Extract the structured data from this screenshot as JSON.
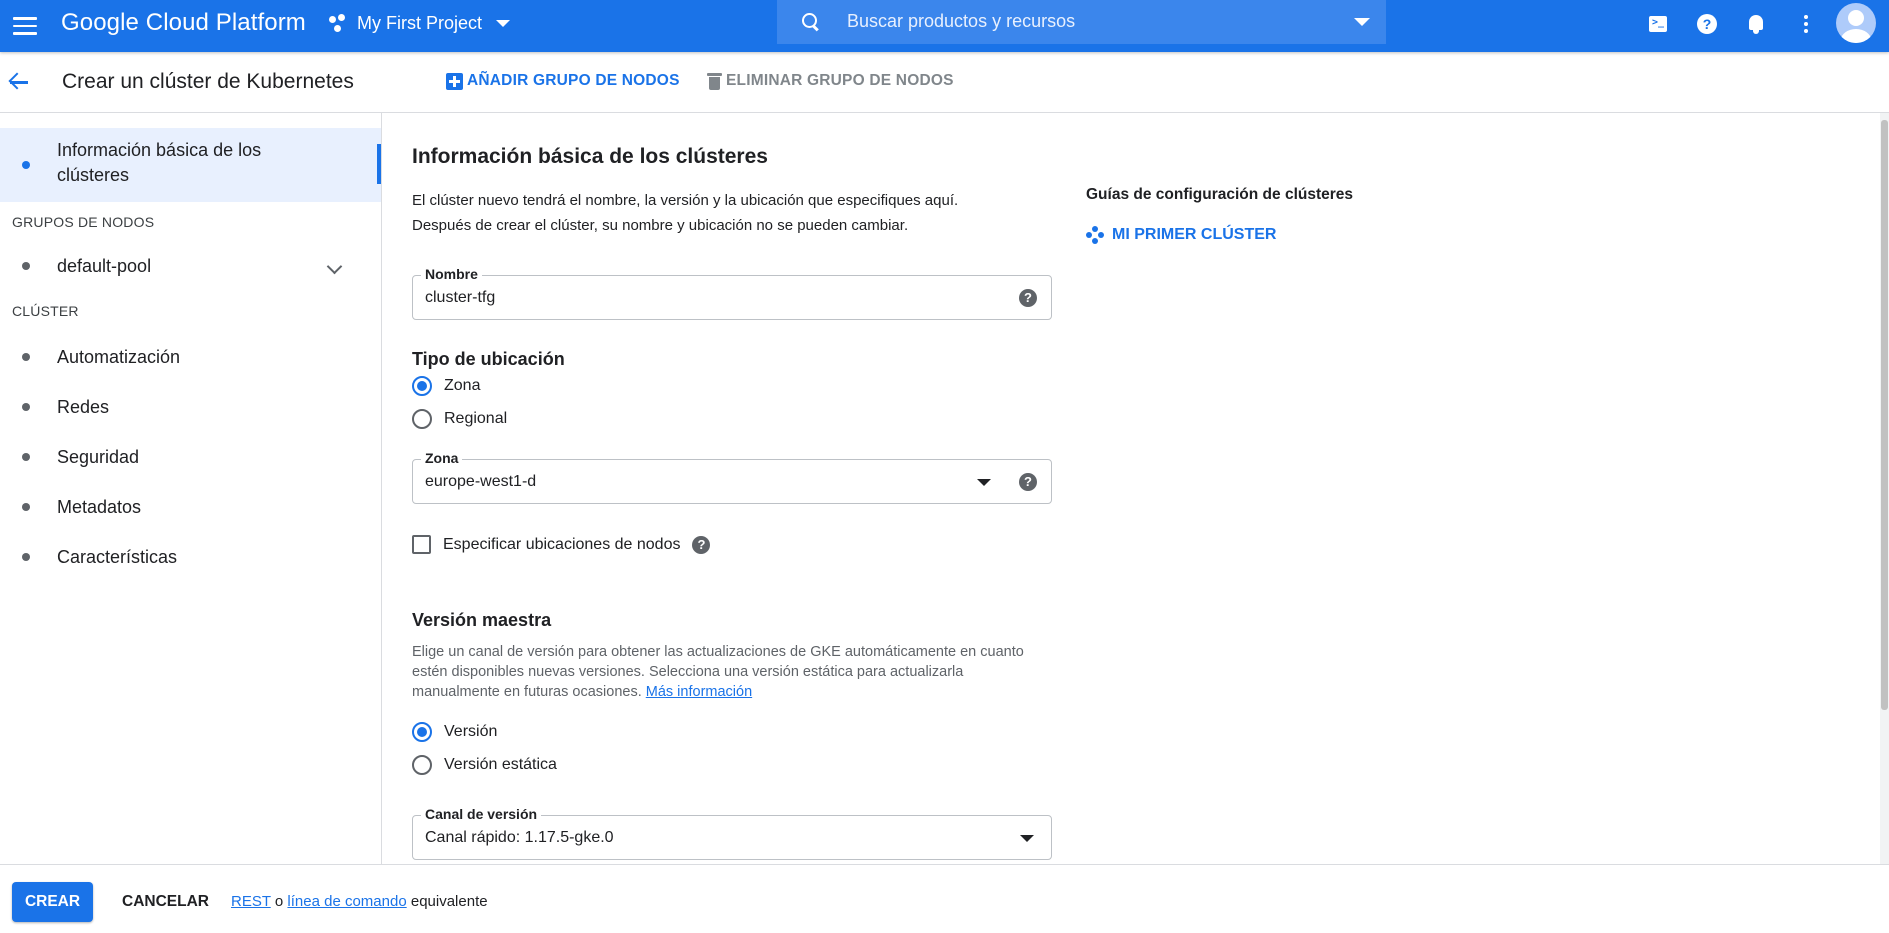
{
  "topbar": {
    "brand": "Google Cloud Platform",
    "project": "My First Project",
    "search_placeholder": "Buscar productos y recursos",
    "accent_color": "#1a73e8",
    "icons": [
      "menu-icon",
      "project-icon",
      "search-icon",
      "cloud-shell-icon",
      "help-icon",
      "notifications-icon",
      "more-vert-icon",
      "account-avatar"
    ]
  },
  "header": {
    "title": "Crear un clúster de Kubernetes",
    "add_node_pool": "AÑADIR GRUPO DE NODOS",
    "delete_node_pool": "ELIMINAR GRUPO DE NODOS"
  },
  "sidebar": {
    "active_item_line1": "Información básica de los",
    "active_item_line2": "clústeres",
    "section_node_pools": "GRUPOS DE NODOS",
    "node_pool_item": "default-pool",
    "section_cluster": "CLÚSTER",
    "items": [
      "Automatización",
      "Redes",
      "Seguridad",
      "Metadatos",
      "Características"
    ]
  },
  "main": {
    "title": "Información básica de los clústeres",
    "description_line1": "El clúster nuevo tendrá el nombre, la versión y la ubicación que especifiques aquí.",
    "description_line2": "Después de crear el clúster, su nombre y ubicación no se pueden cambiar.",
    "name_label": "Nombre",
    "name_value": "cluster-tfg",
    "location_type_title": "Tipo de ubicación",
    "location_options": [
      "Zona",
      "Regional"
    ],
    "location_selected": "Zona",
    "zone_label": "Zona",
    "zone_value": "europe-west1-d",
    "specify_nodes_label": "Especificar ubicaciones de nodos",
    "master_version_title": "Versión maestra",
    "master_version_desc": "Elige un canal de versión para obtener las actualizaciones de GKE automáticamente en cuanto estén disponibles nuevas versiones. Selecciona una versión estática para actualizarla manualmente en futuras ocasiones.",
    "more_info_link": "Más información",
    "version_options": [
      "Versión",
      "Versión estática"
    ],
    "version_selected": "Versión",
    "channel_label": "Canal de versión",
    "channel_value": "Canal rápido: 1.17.5-gke.0"
  },
  "guides": {
    "title": "Guías de configuración de clústeres",
    "link": "MI PRIMER CLÚSTER"
  },
  "footer": {
    "create": "CREAR",
    "cancel": "CANCELAR",
    "rest": "REST",
    "or": "o",
    "command_line": "línea de comando",
    "equivalent": "equivalente"
  }
}
